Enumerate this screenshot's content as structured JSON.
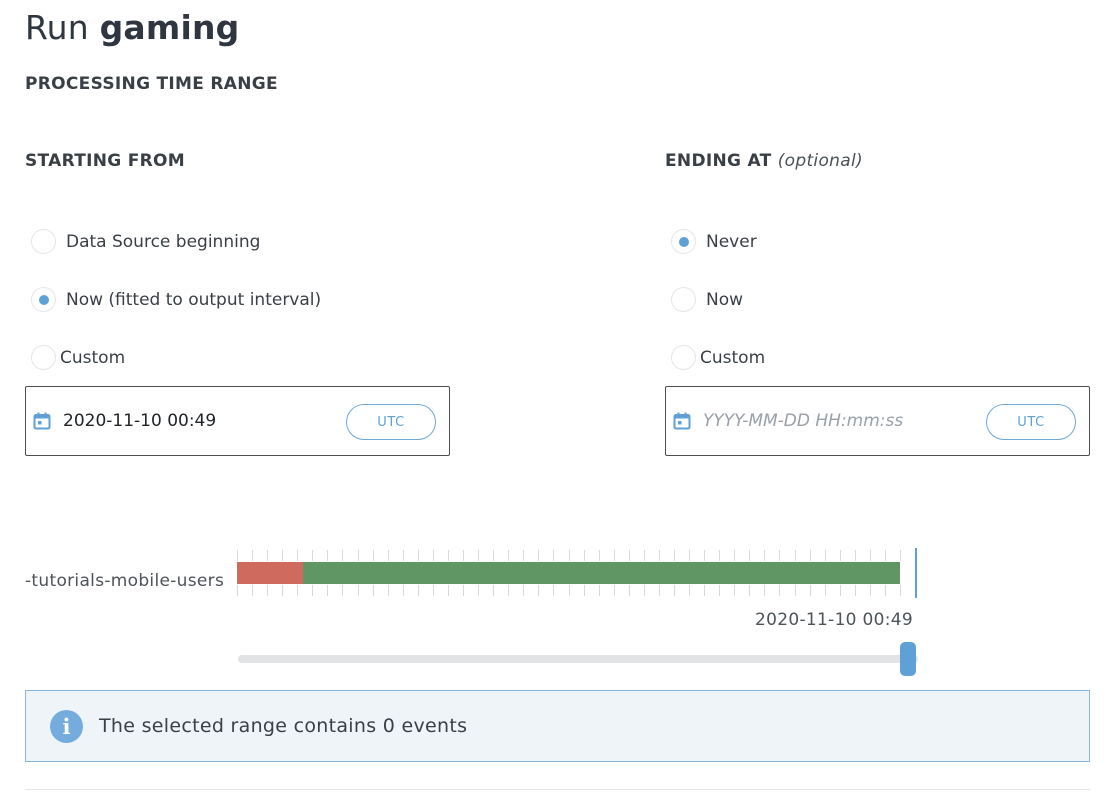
{
  "title": {
    "prefix": "Run ",
    "name": "gaming"
  },
  "processing_time_range": {
    "heading": "PROCESSING TIME RANGE"
  },
  "starting_from": {
    "heading": "STARTING FROM",
    "options": [
      {
        "label": "Data Source beginning",
        "selected": false
      },
      {
        "label": "Now (fitted to output interval)",
        "selected": true
      },
      {
        "label": "Custom",
        "selected": false
      }
    ],
    "date_value": "2020-11-10 00:49",
    "date_placeholder": "",
    "utc_label": "UTC"
  },
  "ending_at": {
    "heading": "ENDING AT",
    "heading_note": "(optional)",
    "options": [
      {
        "label": "Never",
        "selected": true
      },
      {
        "label": "Now",
        "selected": false
      },
      {
        "label": "Custom",
        "selected": false
      }
    ],
    "date_value": "",
    "date_placeholder": "YYYY-MM-DD HH:mm:ss",
    "utc_label": "UTC"
  },
  "timeline": {
    "source_label": "-tutorials-mobile-users",
    "time_label": "2020-11-10 00:49",
    "red_fraction": 0.1,
    "green_fraction": 0.9,
    "slider_position": 1.0
  },
  "info": {
    "text": "The selected range contains 0 events"
  },
  "colors": {
    "accent": "#5fa1d7",
    "bar_red": "#cf6a5e",
    "bar_green": "#5f9664",
    "info_bg": "#eef4f8",
    "info_border": "#8cb6d8"
  },
  "icons": {
    "calendar": "calendar-icon",
    "info": "info-icon"
  }
}
